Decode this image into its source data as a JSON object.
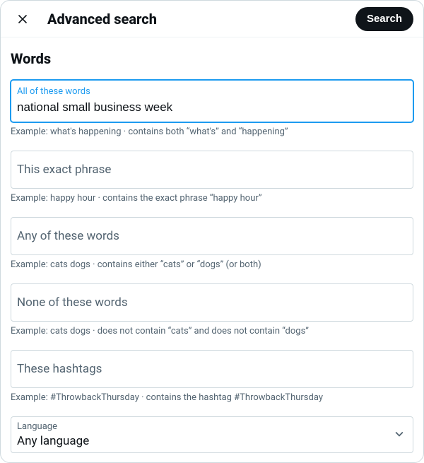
{
  "header": {
    "title": "Advanced search",
    "search_label": "Search"
  },
  "section": {
    "title": "Words"
  },
  "fields": {
    "all_words": {
      "label": "All of these words",
      "value": "national small business week",
      "example": "Example: what's happening · contains both “what's” and “happening”"
    },
    "exact_phrase": {
      "placeholder": "This exact phrase",
      "example": "Example: happy hour · contains the exact phrase “happy hour”"
    },
    "any_words": {
      "placeholder": "Any of these words",
      "example": "Example: cats dogs · contains either “cats” or “dogs” (or both)"
    },
    "none_words": {
      "placeholder": "None of these words",
      "example": "Example: cats dogs · does not contain “cats” and does not contain “dogs”"
    },
    "hashtags": {
      "placeholder": "These hashtags",
      "example": "Example: #ThrowbackThursday · contains the hashtag #ThrowbackThursday"
    }
  },
  "language": {
    "label": "Language",
    "value": "Any language"
  }
}
